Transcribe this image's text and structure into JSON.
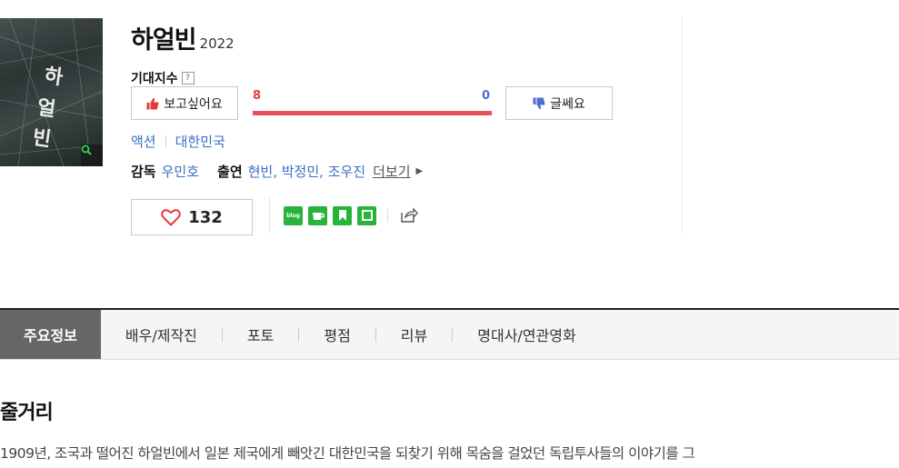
{
  "movie": {
    "title": "하얼빈",
    "year": "2022",
    "poster_text": "하얼빈",
    "expect_label": "기대지수",
    "help_icon": "?",
    "want_label": "보고싶어요",
    "meh_label": "글쎄요",
    "want_count": "8",
    "meh_count": "0",
    "want_fraction": 1.0,
    "genre": "액션",
    "country": "대한민국",
    "director_label": "감독",
    "director": "우민호",
    "cast_label": "출연",
    "cast": "현빈, 박정민, 조우진",
    "more_label": "더보기",
    "likes": "132"
  },
  "share": {
    "icons": [
      "blog-icon",
      "cafe-icon",
      "bookmark-icon",
      "band-icon",
      "share-icon"
    ],
    "blog_text": "blog"
  },
  "tabs": [
    {
      "label": "주요정보",
      "active": true
    },
    {
      "label": "배우/제작진"
    },
    {
      "label": "포토"
    },
    {
      "label": "평점"
    },
    {
      "label": "리뷰"
    },
    {
      "label": "명대사/연관영화"
    }
  ],
  "section": {
    "title": "줄거리",
    "synopsis": "1909년, 조국과 떨어진 하얼빈에서 일본 제국에게 빼앗긴 대한민국을 되찾기 위해 목숨을 걸었던 독립투사들의 이야기를 그"
  },
  "colors": {
    "accent_blue": "#3b6fc4",
    "want_red": "#e63b3b",
    "bar_red": "#e8505b",
    "meh_blue": "#4e6ed6",
    "tab_active": "#666666",
    "share_green": "#27b43b"
  }
}
